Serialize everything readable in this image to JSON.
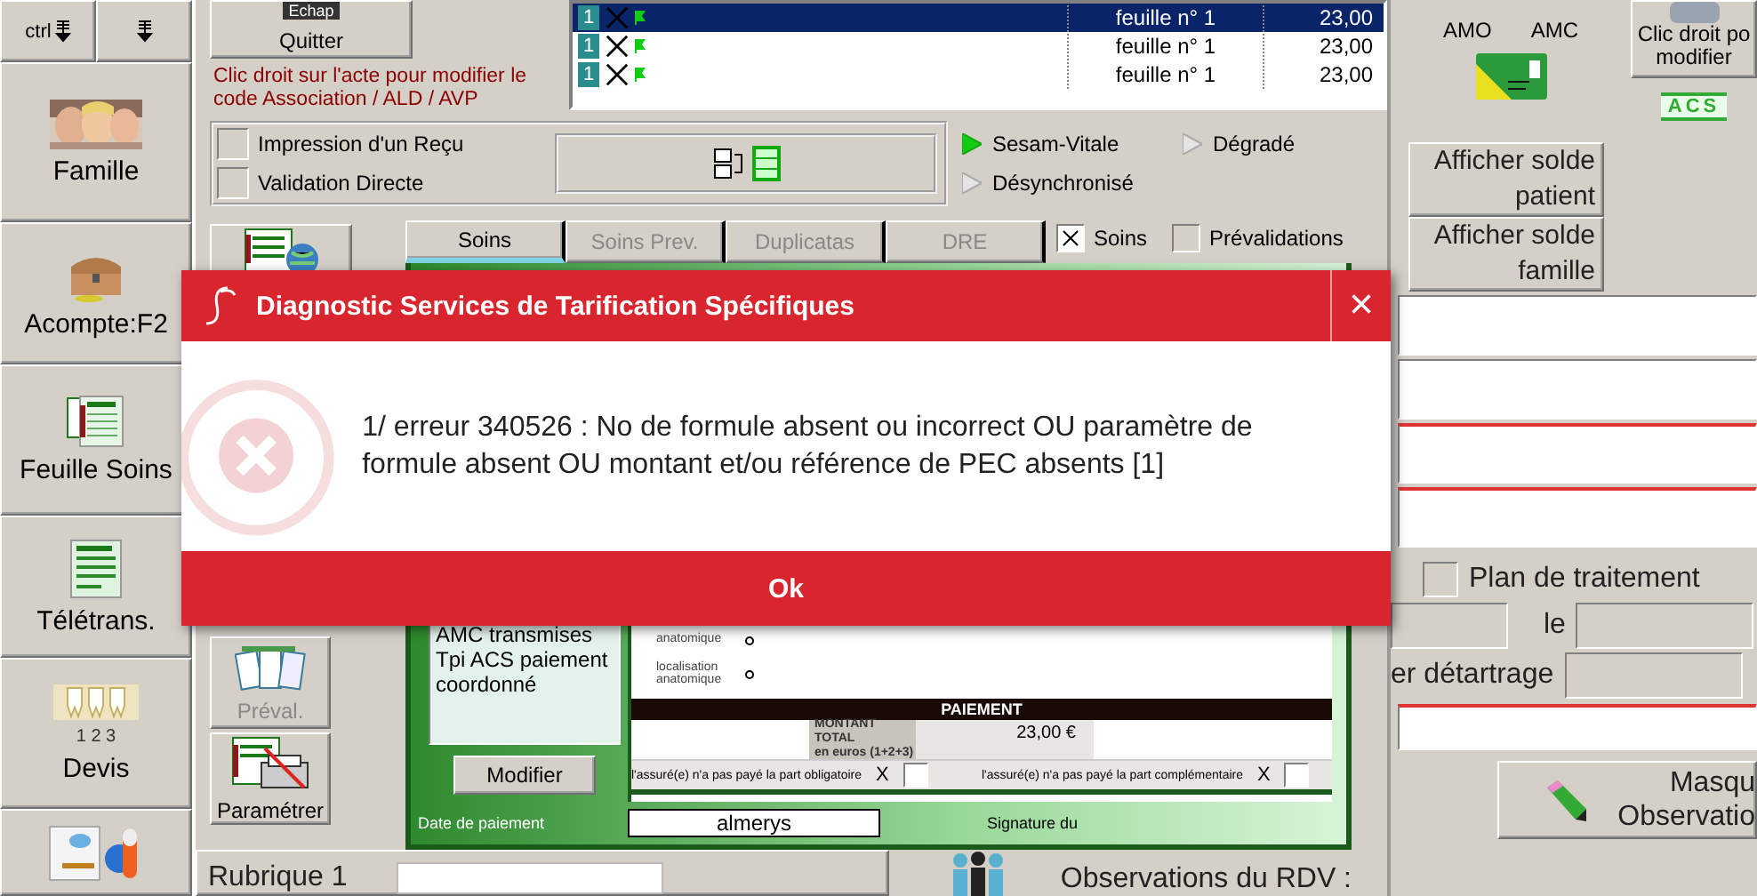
{
  "sidebar": {
    "top_keys": [
      {
        "kind": "ctrl",
        "label": "ctrl"
      },
      {
        "kind": "plain"
      }
    ],
    "items": [
      {
        "kind": "family",
        "label": "Famille"
      },
      {
        "kind": "chest",
        "label": "Acompte:F2"
      },
      {
        "kind": "sheet",
        "label": "Feuille Soins"
      },
      {
        "kind": "teletrans",
        "label": "Télétrans."
      },
      {
        "kind": "quote",
        "label": "Devis",
        "badge": "1 2 3"
      },
      {
        "kind": "meds"
      }
    ]
  },
  "quit_button": {
    "key": "Echap",
    "label": "Quitter"
  },
  "note": "Clic droit sur l'acte pour modifier le code Association / ALD / AVP",
  "acts_table": {
    "rows": [
      {
        "count": "1",
        "sheet": "feuille n° 1",
        "amount": "23,00",
        "selected": true
      },
      {
        "count": "1",
        "sheet": "feuille n° 1",
        "amount": "23,00",
        "selected": false
      },
      {
        "count": "1",
        "sheet": "feuille n° 1",
        "amount": "23,00",
        "selected": false
      }
    ]
  },
  "options": [
    {
      "label": "Impression d'un Reçu",
      "checked": false
    },
    {
      "label": "Validation Directe",
      "checked": false
    }
  ],
  "modes": [
    {
      "label": "Sesam-Vitale",
      "active": true
    },
    {
      "label": "Dégradé",
      "active": false
    },
    {
      "label": "Désynchronisé",
      "active": false
    }
  ],
  "tools": [
    {
      "kind": "sheet"
    },
    {
      "kind": "preval",
      "label": "Préval.",
      "disabled": true
    },
    {
      "kind": "print",
      "label": "Paramétrer",
      "disabled": false
    }
  ],
  "tabs": [
    {
      "label": "Soins",
      "selected": true,
      "disabled": false
    },
    {
      "label": "Soins Prev.",
      "selected": false,
      "disabled": true
    },
    {
      "label": "Duplicatas",
      "selected": false,
      "disabled": true
    },
    {
      "label": "DRE",
      "selected": false,
      "disabled": true
    }
  ],
  "filters": [
    {
      "label": "Soins",
      "checked": true
    },
    {
      "label": "Prévalidations",
      "checked": false
    }
  ],
  "form": {
    "list_items": [
      "AMC transmises",
      "Tpi ACS paiement coordonné"
    ],
    "modify_button": "Modifier",
    "locations": [
      "anatomique",
      "localisation anatomique"
    ],
    "payment_title": "PAIEMENT",
    "total_label": "MONTANT TOTAL",
    "total_sub": "en euros (1+2+3)",
    "total": "23,00 €",
    "unpaid": [
      {
        "label": "l'assuré(e) n'a pas payé la part obligatoire",
        "mark": "X",
        "checked": false
      },
      {
        "label": "l'assuré(e) n'a pas payé la part complémentaire",
        "mark": "X",
        "checked": false
      }
    ],
    "payment_date_label": "Date de paiement",
    "organisme": "almerys",
    "signature_label": "Signature du"
  },
  "rubrique": "Rubrique 1",
  "observations_label": "Observations du RDV :",
  "coverage": [
    "AMO",
    "AMC"
  ],
  "card_button": "Clic droit po modifier",
  "acs": "ACS",
  "balance_buttons": [
    "Afficher solde patient",
    "Afficher solde famille"
  ],
  "plan": {
    "label": "Plan de traitement",
    "checked": false
  },
  "date_label": "le",
  "scaling_label": "er détartrage",
  "hide_button": "Masqu Observatio",
  "dialog": {
    "title": "Diagnostic Services de Tarification Spécifiques",
    "close": "×",
    "message": "1/ erreur 340526 : No de formule absent ou incorrect OU paramètre de formule absent OU montant et/ou référence de PEC absents [1]",
    "ok": "Ok"
  }
}
